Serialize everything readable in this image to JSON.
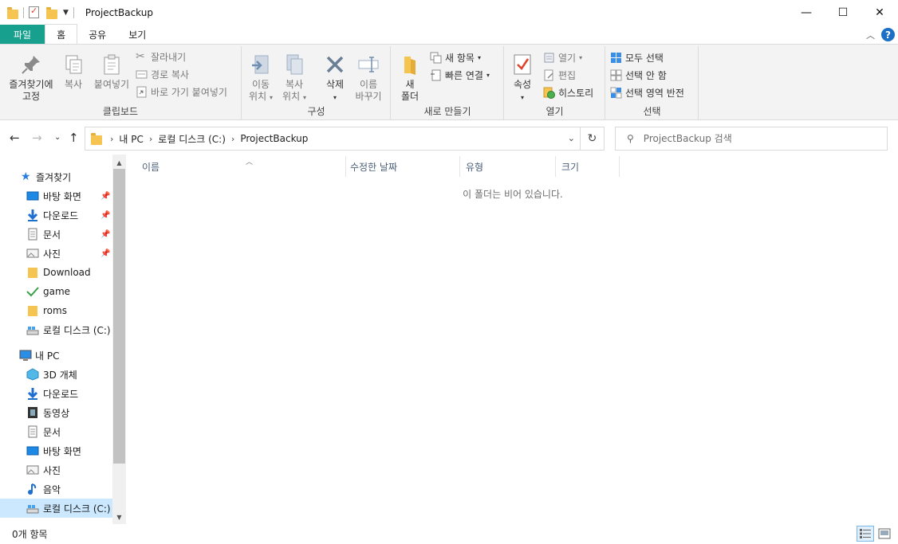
{
  "window": {
    "title": "ProjectBackup",
    "minimize": "—",
    "maximize": "☐",
    "close": "✕"
  },
  "tabs": [
    {
      "label": "파일"
    },
    {
      "label": "홈"
    },
    {
      "label": "공유"
    },
    {
      "label": "보기"
    }
  ],
  "ribbon": {
    "clipboard": {
      "label": "클립보드",
      "pin_line1": "즐겨찾기에",
      "pin_line2": "고정",
      "copy": "복사",
      "paste": "붙여넣기",
      "cut": "잘라내기",
      "copy_path": "경로 복사",
      "paste_shortcut": "바로 가기 붙여넣기"
    },
    "organize": {
      "label": "구성",
      "move_line1": "이동",
      "move_line2": "위치",
      "copy_line1": "복사",
      "copy_line2": "위치",
      "delete": "삭제",
      "rename_line1": "이름",
      "rename_line2": "바꾸기"
    },
    "new": {
      "label": "새로 만들기",
      "folder_line1": "새",
      "folder_line2": "폴더",
      "new_item": "새 항목",
      "easy_access": "빠른 연결"
    },
    "open": {
      "label": "열기",
      "properties": "속성",
      "open": "열기",
      "edit": "편집",
      "history": "히스토리"
    },
    "select": {
      "label": "선택",
      "select_all": "모두 선택",
      "select_none": "선택 안 함",
      "invert": "선택 영역 반전"
    }
  },
  "address": {
    "crumbs": [
      "내 PC",
      "로컬 디스크 (C:)",
      "ProjectBackup"
    ]
  },
  "search": {
    "placeholder": "ProjectBackup 검색"
  },
  "navpane": {
    "quick_access": "즐겨찾기",
    "quick_items": [
      {
        "label": "바탕 화면",
        "pinned": true
      },
      {
        "label": "다운로드",
        "pinned": true
      },
      {
        "label": "문서",
        "pinned": true
      },
      {
        "label": "사진",
        "pinned": true
      },
      {
        "label": "Download"
      },
      {
        "label": "game"
      },
      {
        "label": "roms"
      },
      {
        "label": "로컬 디스크 (C:)"
      }
    ],
    "this_pc": "내 PC",
    "pc_items": [
      {
        "label": "3D 개체"
      },
      {
        "label": "다운로드"
      },
      {
        "label": "동영상"
      },
      {
        "label": "문서"
      },
      {
        "label": "바탕 화면"
      },
      {
        "label": "사진"
      },
      {
        "label": "음악"
      },
      {
        "label": "로컬 디스크 (C:)"
      }
    ]
  },
  "columns": [
    {
      "label": "이름"
    },
    {
      "label": "수정한 날짜"
    },
    {
      "label": "유형"
    },
    {
      "label": "크기"
    }
  ],
  "empty_message": "이 폴더는 비어 있습니다.",
  "status": {
    "item_count": "0개 항목"
  },
  "colors": {
    "file_tab": "#17a08d",
    "help": "#1b6fc4",
    "selection": "#cce8ff",
    "folder": "#f5c451"
  }
}
